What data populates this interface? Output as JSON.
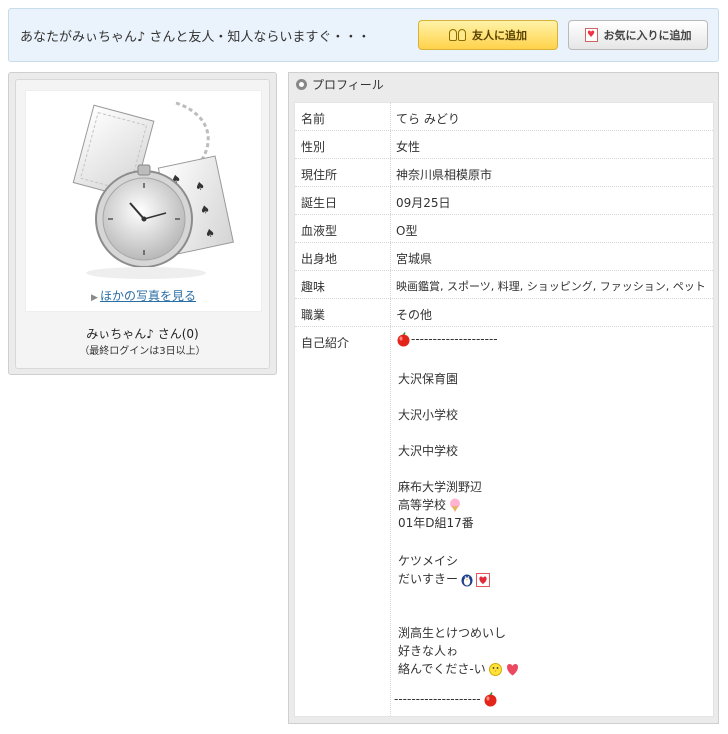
{
  "banner": {
    "message": "あなたがみぃちゃん♪ さんと友人・知人ならいますぐ・・・",
    "add_friend_label": "友人に追加",
    "add_favorite_label": "お気に入りに追加"
  },
  "photo": {
    "more_photos_label": "ほかの写真を見る",
    "user_name": "みぃちゃん♪ さん(0)",
    "last_login": "（最終ログインは3日以上）"
  },
  "profile": {
    "header": "プロフィール",
    "rows": [
      {
        "label": "名前",
        "value": "てら みどり"
      },
      {
        "label": "性別",
        "value": "女性"
      },
      {
        "label": "現住所",
        "value": "神奈川県相模原市"
      },
      {
        "label": "誕生日",
        "value": "09月25日"
      },
      {
        "label": "血液型",
        "value": "O型"
      },
      {
        "label": "出身地",
        "value": "宮城県"
      },
      {
        "label": "趣味",
        "value": "映画鑑賞, スポーツ, 料理, ショッピング, ファッション, ペット"
      },
      {
        "label": "職業",
        "value": "その他"
      }
    ],
    "intro_label": "自己紹介",
    "intro_lines": [
      "--------------------",
      "大沢保育園",
      "大沢小学校",
      "大沢中学校",
      "麻布大学渕野辺",
      "高等学校",
      "01年D組17番",
      "ケツメイシ",
      "だいすきー",
      "渕高生とけつめいし",
      "好きな人ゎ",
      "絡んでくださ-い",
      "--------------------"
    ]
  },
  "icons": {
    "friend_button": "two-people-icon",
    "favorite_button": "bookmark-heart-icon",
    "section_header": "radio-circle-icon",
    "more_link": "right-triangle-icon",
    "intro_emoji": [
      "apple-icon",
      "ice-cream-icon",
      "penguin-icon",
      "heart-box-icon",
      "chick-icon",
      "heart-icon",
      "apple-icon"
    ]
  },
  "colors": {
    "banner_bg": "#eaf3fb",
    "friend_button": "#ffd24a",
    "link": "#2a6ea6"
  }
}
